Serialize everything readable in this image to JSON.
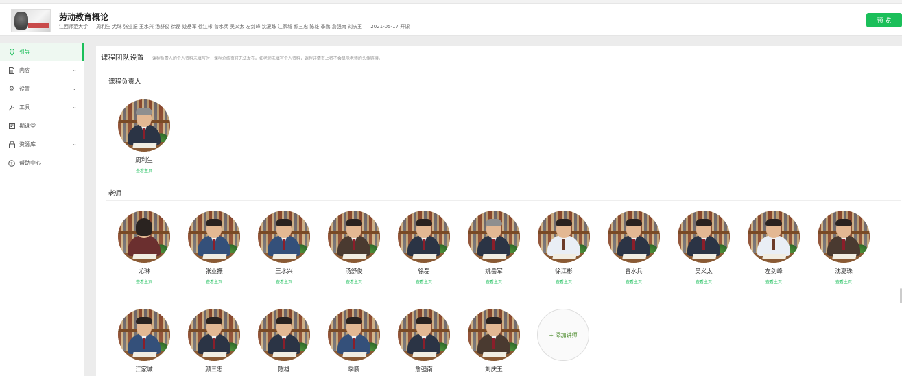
{
  "header": {
    "course_title": "劳动教育概论",
    "school": "江西师范大学",
    "teachers": "周利生 尤琳 张业振 王水兴 汤舒俊 徐磊 姚岳军 徐江彬 曾水兵 吴义太 左剑峰 沈夏珠 江家城 颜三忠 陈雄 季鹏 詹强南 刘庆玉",
    "date": "2021-05-17 开课",
    "preview_label": "预 览"
  },
  "sidebar": {
    "items": [
      {
        "label": "引导",
        "icon": "pin-icon"
      },
      {
        "label": "内容",
        "icon": "file-icon"
      },
      {
        "label": "设置",
        "icon": "gear-icon"
      },
      {
        "label": "工具",
        "icon": "wrench-icon"
      },
      {
        "label": "期课堂",
        "icon": "board-icon"
      },
      {
        "label": "资源库",
        "icon": "lock-icon"
      },
      {
        "label": "帮助中心",
        "icon": "question-icon"
      }
    ]
  },
  "main": {
    "section_title": "课程团队设置",
    "section_desc": "课程负责人的个人资料未填写时，课程介绍页将无法发布。如老师未填写个人资料，课程详情页上将不会显示老师的头像链接。",
    "leader_title": "课程负责人",
    "teacher_title": "老师",
    "link_label": "查看主页",
    "add_label": "+ 添加讲师",
    "leader": {
      "name": "周利生"
    },
    "teachers": [
      {
        "name": "尤琳"
      },
      {
        "name": "张业振"
      },
      {
        "name": "王水兴"
      },
      {
        "name": "汤舒俊"
      },
      {
        "name": "徐磊"
      },
      {
        "name": "姚岳军"
      },
      {
        "name": "徐江彬"
      },
      {
        "name": "曾水兵"
      },
      {
        "name": "吴义太"
      },
      {
        "name": "左剑峰"
      },
      {
        "name": "沈夏珠"
      },
      {
        "name": "江家城"
      },
      {
        "name": "颜三忠"
      },
      {
        "name": "陈雄"
      },
      {
        "name": "季鹏"
      },
      {
        "name": "詹强南"
      },
      {
        "name": "刘庆玉"
      }
    ]
  },
  "colors": {
    "accent": "#1bbf5a"
  }
}
